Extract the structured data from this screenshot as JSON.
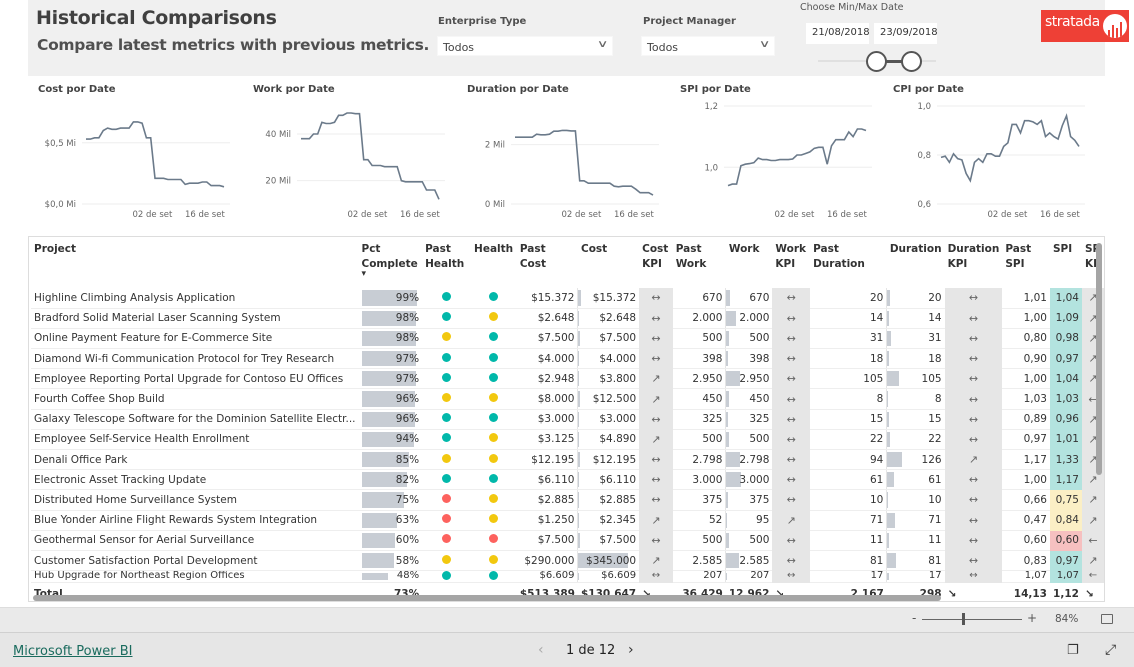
{
  "header": {
    "title": "Historical Comparisons",
    "subtitle": "Compare latest metrics with previous metrics.",
    "enterprise_type": {
      "label": "Enterprise Type",
      "value": "Todos"
    },
    "project_manager": {
      "label": "Project Manager",
      "value": "Todos"
    },
    "date_range": {
      "label": "Choose Min/Max Date",
      "min": "21/08/2018",
      "max": "23/09/2018"
    },
    "logo_text": "stratada",
    "chevron": "∨"
  },
  "charts": [
    {
      "title": "Cost por Date",
      "y_ticks": [
        "$0,0 Mi",
        "$0,5 Mi"
      ],
      "tick_values": [
        0,
        0.5
      ],
      "ylim": [
        0,
        0.8
      ],
      "x_ticks": [
        "02 de set",
        "16 de set"
      ],
      "values": [
        0.53,
        0.53,
        0.54,
        0.54,
        0.6,
        0.62,
        0.61,
        0.61,
        0.62,
        0.62,
        0.62,
        0.67,
        0.67,
        0.66,
        0.54,
        0.54,
        0.21,
        0.21,
        0.21,
        0.2,
        0.2,
        0.2,
        0.2,
        0.16,
        0.17,
        0.17,
        0.17,
        0.18,
        0.18,
        0.15,
        0.15,
        0.15,
        0.14
      ]
    },
    {
      "title": "Work por Date",
      "y_ticks": [
        "20 Mil",
        "40 Mil"
      ],
      "tick_values": [
        20,
        40
      ],
      "ylim": [
        10,
        52
      ],
      "x_ticks": [
        "02 de set",
        "16 de set"
      ],
      "values": [
        38,
        38,
        38,
        40,
        40,
        45,
        44.5,
        44.5,
        45,
        48,
        48,
        49,
        49,
        48.7,
        48.7,
        29,
        29,
        26.5,
        26.5,
        26.5,
        26,
        26,
        26,
        26,
        20,
        19.5,
        19.5,
        19.5,
        19.5,
        19.5,
        16,
        16,
        16,
        12
      ]
    },
    {
      "title": "Duration por Date",
      "y_ticks": [
        "0 Mil",
        "2 Mil"
      ],
      "tick_values": [
        0,
        2
      ],
      "ylim": [
        0,
        3.3
      ],
      "x_ticks": [
        "02 de set",
        "16 de set"
      ],
      "values": [
        2.25,
        2.25,
        2.25,
        2.25,
        2.25,
        2.35,
        2.33,
        2.33,
        2.35,
        2.45,
        2.45,
        2.48,
        2.48,
        2.46,
        2.46,
        0.78,
        0.78,
        0.7,
        0.7,
        0.7,
        0.7,
        0.7,
        0.7,
        0.6,
        0.58,
        0.6,
        0.6,
        0.6,
        0.5,
        0.38,
        0.38,
        0.38,
        0.3
      ]
    },
    {
      "title": "SPI por Date",
      "y_ticks": [
        "1,0",
        "1,2"
      ],
      "tick_values": [
        1.0,
        1.2
      ],
      "ylim": [
        0.88,
        1.2
      ],
      "x_ticks": [
        "02 de set",
        "16 de set"
      ],
      "values": [
        0.94,
        0.945,
        0.945,
        1.005,
        1.01,
        1.012,
        1.015,
        1.03,
        1.025,
        1.025,
        1.022,
        1.022,
        1.025,
        1.025,
        1.025,
        1.027,
        1.04,
        1.04,
        1.045,
        1.05,
        1.062,
        1.065,
        1.065,
        1.01,
        1.07,
        1.09,
        1.09,
        1.09,
        1.115,
        1.1,
        1.125,
        1.125,
        1.12
      ]
    },
    {
      "title": "CPI por Date",
      "y_ticks": [
        "0,6",
        "0,8",
        "1,0"
      ],
      "tick_values": [
        0.6,
        0.8,
        1.0
      ],
      "ylim": [
        0.6,
        1.0
      ],
      "x_ticks": [
        "02 de set",
        "16 de set"
      ],
      "values": [
        0.79,
        0.795,
        0.77,
        0.805,
        0.785,
        0.78,
        0.725,
        0.695,
        0.77,
        0.785,
        0.77,
        0.805,
        0.805,
        0.795,
        0.795,
        0.835,
        0.85,
        0.925,
        0.925,
        0.89,
        0.94,
        0.94,
        0.935,
        0.925,
        0.94,
        0.875,
        0.89,
        0.875,
        0.865,
        0.92,
        0.96,
        0.875,
        0.86,
        0.835
      ]
    }
  ],
  "table": {
    "headers": [
      "Project",
      "Pct Complete",
      "Past Health",
      "Health",
      "Past Cost",
      "Cost",
      "Cost KPI",
      "Past Work",
      "Work",
      "Work KPI",
      "Past Duration",
      "Duration",
      "Duration KPI",
      "Past SPI",
      "SPI",
      "SPI KPI"
    ],
    "header_lines": {
      "pct": [
        "Pct",
        "Complete"
      ],
      "past_health": [
        "Past",
        "Health"
      ],
      "cost_kpi": [
        "Cost",
        "KPI"
      ],
      "work_kpi": [
        "Work",
        "KPI"
      ],
      "duration_kpi": [
        "Duration",
        "KPI"
      ],
      "spi_kpi": [
        "SP",
        "KP"
      ]
    },
    "sort_indicator": "▾",
    "rows": [
      {
        "project": "Highline Climbing Analysis Application",
        "pct": "99%",
        "pct_value": 99,
        "past_health": "green",
        "health": "green",
        "past_cost": "$15.372",
        "cost": "$15.372",
        "cost_kpi": "↔",
        "past_work": "670",
        "work": "670",
        "work_kpi": "↔",
        "past_duration": "20",
        "duration": "20",
        "duration_kpi": "↔",
        "past_spi": "1,01",
        "spi": "1,04",
        "spi_color": "green",
        "spi_kpi": "↗"
      },
      {
        "project": "Bradford Solid Material Laser Scanning System",
        "pct": "98%",
        "pct_value": 98,
        "past_health": "green",
        "health": "yellow",
        "past_cost": "$2.648",
        "cost": "$2.648",
        "cost_kpi": "↔",
        "past_work": "2.000",
        "work": "2.000",
        "work_kpi": "↔",
        "past_duration": "14",
        "duration": "14",
        "duration_kpi": "↔",
        "past_spi": "1,00",
        "spi": "1,09",
        "spi_color": "green",
        "spi_kpi": "↗"
      },
      {
        "project": "Online Payment Feature for E-Commerce Site",
        "pct": "98%",
        "pct_value": 98,
        "past_health": "yellow",
        "health": "green",
        "past_cost": "$7.500",
        "cost": "$7.500",
        "cost_kpi": "↔",
        "past_work": "500",
        "work": "500",
        "work_kpi": "↔",
        "past_duration": "31",
        "duration": "31",
        "duration_kpi": "↔",
        "past_spi": "0,80",
        "spi": "0,98",
        "spi_color": "green",
        "spi_kpi": "↗"
      },
      {
        "project": "Diamond Wi-fi Communication Protocol for Trey Research",
        "pct": "97%",
        "pct_value": 97,
        "past_health": "green",
        "health": "green",
        "past_cost": "$4.000",
        "cost": "$4.000",
        "cost_kpi": "↔",
        "past_work": "398",
        "work": "398",
        "work_kpi": "↔",
        "past_duration": "18",
        "duration": "18",
        "duration_kpi": "↔",
        "past_spi": "0,90",
        "spi": "0,97",
        "spi_color": "green",
        "spi_kpi": "↗"
      },
      {
        "project": "Employee Reporting Portal Upgrade for Contoso EU Offices",
        "pct": "97%",
        "pct_value": 97,
        "past_health": "green",
        "health": "green",
        "past_cost": "$2.948",
        "cost": "$3.800",
        "cost_kpi": "↗",
        "past_work": "2.950",
        "work": "2.950",
        "work_kpi": "↔",
        "past_duration": "105",
        "duration": "105",
        "duration_kpi": "↔",
        "past_spi": "1,00",
        "spi": "1,04",
        "spi_color": "green",
        "spi_kpi": "↗"
      },
      {
        "project": "Fourth Coffee Shop Build",
        "pct": "96%",
        "pct_value": 96,
        "past_health": "yellow",
        "health": "yellow",
        "past_cost": "$8.000",
        "cost": "$12.500",
        "cost_kpi": "↗",
        "past_work": "450",
        "work": "450",
        "work_kpi": "↔",
        "past_duration": "8",
        "duration": "8",
        "duration_kpi": "↔",
        "past_spi": "1,03",
        "spi": "1,03",
        "spi_color": "green",
        "spi_kpi": "←"
      },
      {
        "project": "Galaxy Telescope Software for the Dominion Satellite Electr...",
        "pct": "96%",
        "pct_value": 96,
        "past_health": "green",
        "health": "green",
        "past_cost": "$3.000",
        "cost": "$3.000",
        "cost_kpi": "↔",
        "past_work": "325",
        "work": "325",
        "work_kpi": "↔",
        "past_duration": "15",
        "duration": "15",
        "duration_kpi": "↔",
        "past_spi": "0,89",
        "spi": "0,96",
        "spi_color": "green",
        "spi_kpi": "↗"
      },
      {
        "project": "Employee Self-Service Health Enrollment",
        "pct": "94%",
        "pct_value": 94,
        "past_health": "green",
        "health": "yellow",
        "past_cost": "$3.125",
        "cost": "$4.890",
        "cost_kpi": "↗",
        "past_work": "500",
        "work": "500",
        "work_kpi": "↔",
        "past_duration": "22",
        "duration": "22",
        "duration_kpi": "↔",
        "past_spi": "0,97",
        "spi": "1,01",
        "spi_color": "green",
        "spi_kpi": "↗"
      },
      {
        "project": "Denali Office Park",
        "pct": "85%",
        "pct_value": 85,
        "past_health": "yellow",
        "health": "yellow",
        "past_cost": "$12.195",
        "cost": "$12.195",
        "cost_kpi": "↔",
        "past_work": "2.798",
        "work": "2.798",
        "work_kpi": "↔",
        "past_duration": "94",
        "duration": "126",
        "duration_kpi": "↗",
        "past_spi": "1,17",
        "spi": "1,33",
        "spi_color": "green",
        "spi_kpi": "↗"
      },
      {
        "project": "Electronic Asset Tracking Update",
        "pct": "82%",
        "pct_value": 82,
        "past_health": "green",
        "health": "green",
        "past_cost": "$6.110",
        "cost": "$6.110",
        "cost_kpi": "↔",
        "past_work": "3.000",
        "work": "3.000",
        "work_kpi": "↔",
        "past_duration": "61",
        "duration": "61",
        "duration_kpi": "↔",
        "past_spi": "1,00",
        "spi": "1,17",
        "spi_color": "green",
        "spi_kpi": "↗"
      },
      {
        "project": "Distributed Home Surveillance System",
        "pct": "75%",
        "pct_value": 75,
        "past_health": "red",
        "health": "yellow",
        "past_cost": "$2.885",
        "cost": "$2.885",
        "cost_kpi": "↔",
        "past_work": "375",
        "work": "375",
        "work_kpi": "↔",
        "past_duration": "10",
        "duration": "10",
        "duration_kpi": "↔",
        "past_spi": "0,66",
        "spi": "0,75",
        "spi_color": "yellow",
        "spi_kpi": "↗"
      },
      {
        "project": "Blue Yonder Airline Flight Rewards System Integration",
        "pct": "63%",
        "pct_value": 63,
        "past_health": "red",
        "health": "yellow",
        "past_cost": "$1.250",
        "cost": "$2.345",
        "cost_kpi": "↗",
        "past_work": "52",
        "work": "95",
        "work_kpi": "↗",
        "past_duration": "71",
        "duration": "71",
        "duration_kpi": "↔",
        "past_spi": "0,47",
        "spi": "0,84",
        "spi_color": "yellow",
        "spi_kpi": "↗"
      },
      {
        "project": "Geothermal Sensor for Aerial Surveillance",
        "pct": "60%",
        "pct_value": 60,
        "past_health": "red",
        "health": "red",
        "past_cost": "$7.500",
        "cost": "$7.500",
        "cost_kpi": "↔",
        "past_work": "500",
        "work": "500",
        "work_kpi": "↔",
        "past_duration": "11",
        "duration": "11",
        "duration_kpi": "↔",
        "past_spi": "0,60",
        "spi": "0,60",
        "spi_color": "red",
        "spi_kpi": "←"
      },
      {
        "project": "Customer Satisfaction Portal Development",
        "pct": "58%",
        "pct_value": 58,
        "past_health": "yellow",
        "health": "yellow",
        "past_cost": "$290.000",
        "cost": "$345.000",
        "cost_kpi": "↗",
        "past_work": "2.585",
        "work": "2.585",
        "work_kpi": "↔",
        "past_duration": "81",
        "duration": "81",
        "duration_kpi": "↔",
        "past_spi": "0,83",
        "spi": "0,97",
        "spi_color": "green",
        "spi_kpi": "↗"
      },
      {
        "project": "Hub Upgrade for Northeast Region Offices",
        "pct": "48%",
        "pct_value": 48,
        "past_health": "green",
        "health": "green",
        "past_cost": "$6.609",
        "cost": "$6.609",
        "cost_kpi": "↔",
        "past_work": "207",
        "work": "207",
        "work_kpi": "↔",
        "past_duration": "17",
        "duration": "17",
        "duration_kpi": "↔",
        "past_spi": "1,07",
        "spi": "1,07",
        "spi_color": "green",
        "spi_kpi": "←"
      }
    ],
    "total": {
      "label": "Total",
      "pct": "73%",
      "past_cost": "$513.389",
      "cost": "$130.647",
      "cost_kpi": "↘",
      "past_work": "36.429",
      "work": "12.962",
      "work_kpi": "↘",
      "past_duration": "2.167",
      "duration": "298",
      "duration_kpi": "↘",
      "past_spi": "14,13",
      "spi": "1,12",
      "spi_kpi": "↘"
    }
  },
  "colors": {
    "green": "#01b8aa",
    "yellow": "#f2c80f",
    "red": "#fd625e",
    "spi_green": "#b3e3df",
    "spi_yellow": "#fbefc5",
    "spi_red": "#f6c0c0",
    "line": "#6b7a8a",
    "brand": "#ee4036"
  },
  "footer": {
    "zoom_minus": "-",
    "zoom_plus": "+",
    "zoom_level": "84%",
    "powerbi_link": "Microsoft Power BI",
    "page_prev": "‹",
    "page_indicator": "1 de 12",
    "page_next": "›",
    "share_icon": "❐",
    "expand_icon": "⤢"
  }
}
